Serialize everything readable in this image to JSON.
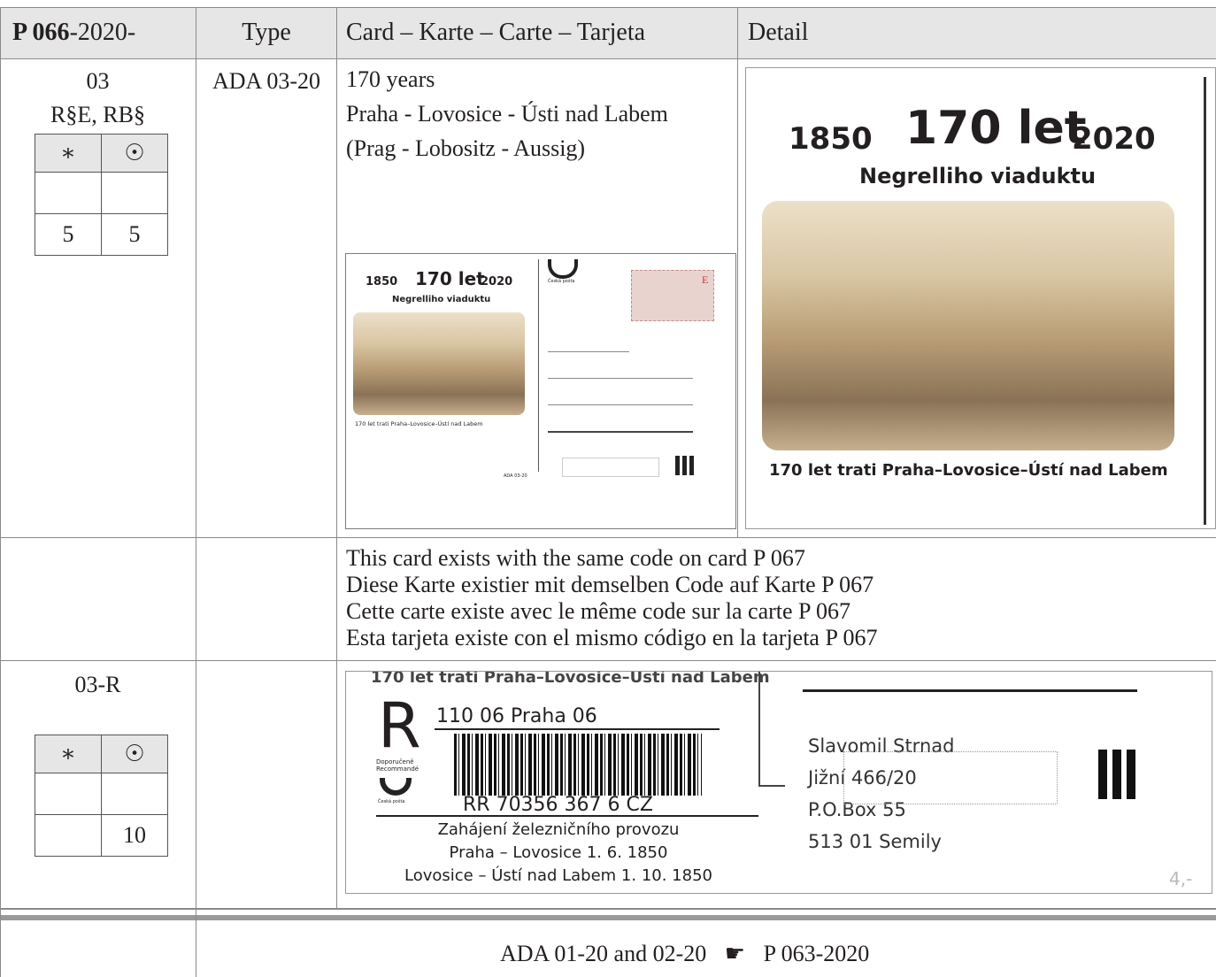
{
  "header": {
    "code_prefix": "P 066",
    "code_suffix": "-2020-",
    "col_type": "Type",
    "col_card": "Card – Karte – Carte – Tarjeta",
    "col_detail": "Detail"
  },
  "entry1": {
    "number": "03",
    "variant": "R§E, RB§",
    "type": "ADA 03-20",
    "title": "170 years",
    "route": "Praha - Lovosice - Ústi nad Labem",
    "route_de": "(Prag - Lobositz - Aussig)",
    "mint_symbol": "∗",
    "used_symbol": "☉",
    "mint_price": "5",
    "used_price": "5"
  },
  "card_image": {
    "year_left": "1850",
    "headline": "170 let",
    "year_right": "2020",
    "subtitle": "Negrelliho viaduktu",
    "caption": "170 let trati Praha–Lovosice–Ústí nad Labem",
    "post_label": "Česká pošta",
    "stamp_letter": "E",
    "code_label": "ADA 03-20"
  },
  "note": {
    "en": "This card exists with the same code on card P 067",
    "de": "Diese Karte existier mit demselben Code auf Karte P 067",
    "fr": "Cette carte existe avec le même code sur la carte P 067",
    "es": "Esta tarjeta existe con el mismo código en la tarjeta P 067"
  },
  "entry2": {
    "number": "03-R",
    "mint_symbol": "∗",
    "used_symbol": "☉",
    "mint_price": "",
    "used_price": "10"
  },
  "registered_image": {
    "top_caption": "170 let trati Praha–Lovosice–Ústí nad Labem",
    "r_letter": "R",
    "r_label1": "Doporučeně",
    "r_label2": "Recommandé",
    "post_label": "Česká pošta",
    "office": "110 06  Praha 06",
    "barcode_number": "RR 70356 367 6 CZ",
    "event_line1": "Zahájení železničního provozu",
    "event_line2": "Praha – Lovosice 1. 6. 1850",
    "event_line3": "Lovosice – Ústí nad Labem 1. 10. 1850",
    "addr1": "Slavomil Strnad",
    "addr2": "Jižní 466/20",
    "addr3": "P.O.Box 55",
    "addr4": "513 01 Semily",
    "pencil": "4,-"
  },
  "footer": {
    "text_left": "ADA 01-20  and 02-20",
    "pointer_icon": "pointing-hand-icon",
    "text_right": "P 063-2020"
  }
}
